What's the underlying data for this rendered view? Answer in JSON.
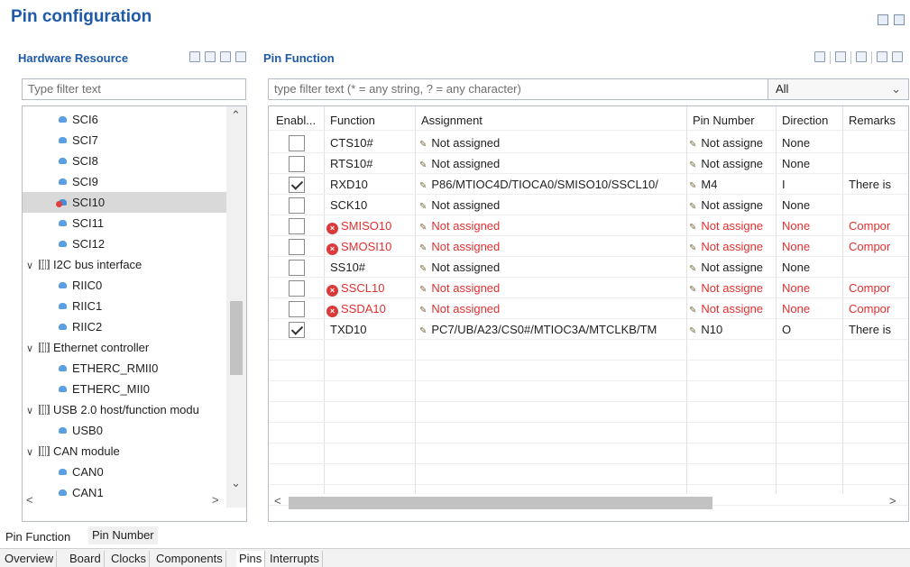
{
  "page": {
    "title": "Pin configuration"
  },
  "hardware": {
    "header": "Hardware Resource",
    "filter_placeholder": "Type filter text",
    "tree": [
      {
        "label": "SCI6",
        "kind": "item"
      },
      {
        "label": "SCI7",
        "kind": "item"
      },
      {
        "label": "SCI8",
        "kind": "item"
      },
      {
        "label": "SCI9",
        "kind": "item"
      },
      {
        "label": "SCI10",
        "kind": "item-error",
        "selected": true
      },
      {
        "label": "SCI11",
        "kind": "item"
      },
      {
        "label": "SCI12",
        "kind": "item"
      },
      {
        "label": "I2C bus interface",
        "kind": "group"
      },
      {
        "label": "RIIC0",
        "kind": "item"
      },
      {
        "label": "RIIC1",
        "kind": "item"
      },
      {
        "label": "RIIC2",
        "kind": "item"
      },
      {
        "label": "Ethernet controller",
        "kind": "group"
      },
      {
        "label": "ETHERC_RMII0",
        "kind": "item"
      },
      {
        "label": "ETHERC_MII0",
        "kind": "item"
      },
      {
        "label": "USB 2.0 host/function modu",
        "kind": "group"
      },
      {
        "label": "USB0",
        "kind": "item"
      },
      {
        "label": "CAN module",
        "kind": "group"
      },
      {
        "label": "CAN0",
        "kind": "item"
      },
      {
        "label": "CAN1",
        "kind": "item"
      }
    ]
  },
  "pin_function": {
    "header": "Pin Function",
    "filter_placeholder": "type filter text (* = any string, ? = any character)",
    "filter_select": "All",
    "columns": [
      "Enabl...",
      "Function",
      "Assignment",
      "Pin Number",
      "Direction",
      "Remarks"
    ],
    "rows": [
      {
        "enabled": false,
        "function": "CTS10#",
        "assignment": "Not assigned",
        "pin": "Not assigne",
        "direction": "None",
        "remarks": "",
        "error": false
      },
      {
        "enabled": false,
        "function": "RTS10#",
        "assignment": "Not assigned",
        "pin": "Not assigne",
        "direction": "None",
        "remarks": "",
        "error": false
      },
      {
        "enabled": true,
        "function": "RXD10",
        "assignment": "P86/MTIOC4D/TIOCA0/SMISO10/SSCL10/",
        "pin": "M4",
        "direction": "I",
        "remarks": "There is",
        "error": false
      },
      {
        "enabled": false,
        "function": "SCK10",
        "assignment": "Not assigned",
        "pin": "Not assigne",
        "direction": "None",
        "remarks": "",
        "error": false
      },
      {
        "enabled": false,
        "function": "SMISO10",
        "assignment": "Not assigned",
        "pin": "Not assigne",
        "direction": "None",
        "remarks": "Compor",
        "error": true
      },
      {
        "enabled": false,
        "function": "SMOSI10",
        "assignment": "Not assigned",
        "pin": "Not assigne",
        "direction": "None",
        "remarks": "Compor",
        "error": true
      },
      {
        "enabled": false,
        "function": "SS10#",
        "assignment": "Not assigned",
        "pin": "Not assigne",
        "direction": "None",
        "remarks": "",
        "error": false
      },
      {
        "enabled": false,
        "function": "SSCL10",
        "assignment": "Not assigned",
        "pin": "Not assigne",
        "direction": "None",
        "remarks": "Compor",
        "error": true
      },
      {
        "enabled": false,
        "function": "SSDA10",
        "assignment": "Not assigned",
        "pin": "Not assigne",
        "direction": "None",
        "remarks": "Compor",
        "error": true
      },
      {
        "enabled": true,
        "function": "TXD10",
        "assignment": "PC7/UB/A23/CS0#/MTIOC3A/MTCLKB/TM",
        "pin": "N10",
        "direction": "O",
        "remarks": "There is",
        "error": false
      }
    ]
  },
  "view_tabs": [
    "Pin Function",
    "Pin Number"
  ],
  "editor_tabs": [
    "Overview",
    "Board",
    "Clocks",
    "Components",
    "Pins",
    "Interrupts"
  ],
  "colors": {
    "accent": "#1e5aa8",
    "error": "#e03030",
    "selection": "#d9d9d9"
  }
}
